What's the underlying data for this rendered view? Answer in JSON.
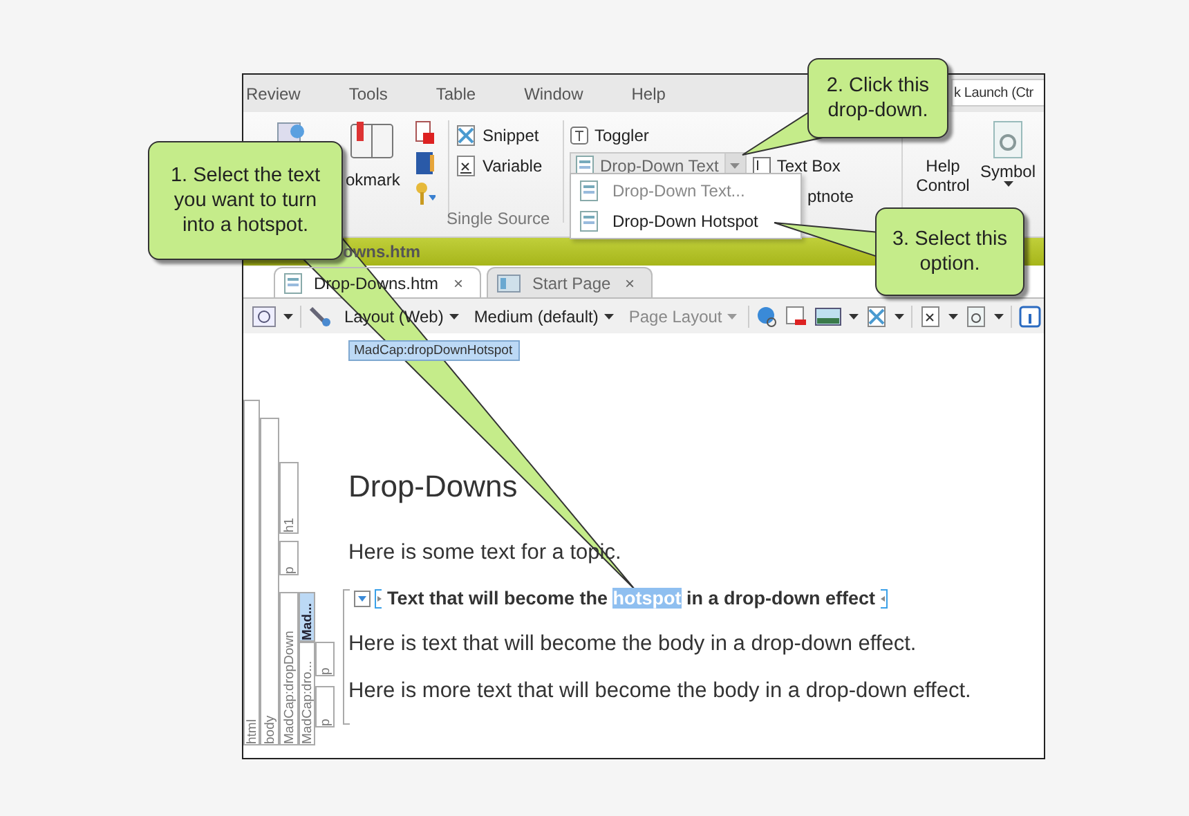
{
  "menu": [
    "Review",
    "Tools",
    "Table",
    "Window",
    "Help"
  ],
  "quick_launch": {
    "placeholder": "k Launch (Ctr"
  },
  "ribbon": {
    "bookmark_label": "okmark",
    "snippet": "Snippet",
    "variable": "Variable",
    "group_label": "Single Source",
    "toggler": "Toggler",
    "dropdown_button": "Drop-Down Text",
    "text_box": "Text Box",
    "footnote": "ptnote",
    "help_control": [
      "Help",
      "Control"
    ],
    "symbol": "Symbol"
  },
  "dropdown_menu": [
    {
      "label": "Drop-Down Text...",
      "disabled": true
    },
    {
      "label": "Drop-Down Hotspot",
      "disabled": false
    }
  ],
  "document_title": "owns.htm",
  "tabs": [
    {
      "label": "Drop-Downs.htm",
      "selected": true,
      "close": "×"
    },
    {
      "label": "Start Page",
      "selected": false,
      "close": "×"
    }
  ],
  "toolbar": [
    {
      "label": "Layout (Web)",
      "disabled": false
    },
    {
      "label": "Medium (default)",
      "disabled": false
    },
    {
      "label": "Page Layout",
      "disabled": true
    }
  ],
  "tag_label": "MadCap:dropDownHotspot",
  "structure": [
    {
      "label": "html",
      "selected": false
    },
    {
      "label": "body",
      "selected": false
    },
    {
      "label": "h1",
      "selected": false
    },
    {
      "label": "p",
      "selected": false
    },
    {
      "label": "MadCap:dropDown",
      "selected": false
    },
    {
      "label": "Mad...",
      "selected": true
    },
    {
      "label": "MadCap:dro...",
      "selected": false
    },
    {
      "label": "p",
      "selected": false
    },
    {
      "label": "p",
      "selected": false
    }
  ],
  "content": {
    "heading": "Drop-Downs",
    "intro": "Here is some text for a topic.",
    "hotspot": {
      "before": "Text that will become the ",
      "selected": "hotspot",
      "after": " in a drop-down effect"
    },
    "body": [
      "Here is text that will become the body in a drop-down effect.",
      "Here is more text that will become the body in a drop-down effect."
    ]
  },
  "callouts": [
    {
      "text": "1. Select the text you want to turn into a hotspot."
    },
    {
      "text": "2. Click this drop-down."
    },
    {
      "text": "3. Select this option."
    }
  ]
}
